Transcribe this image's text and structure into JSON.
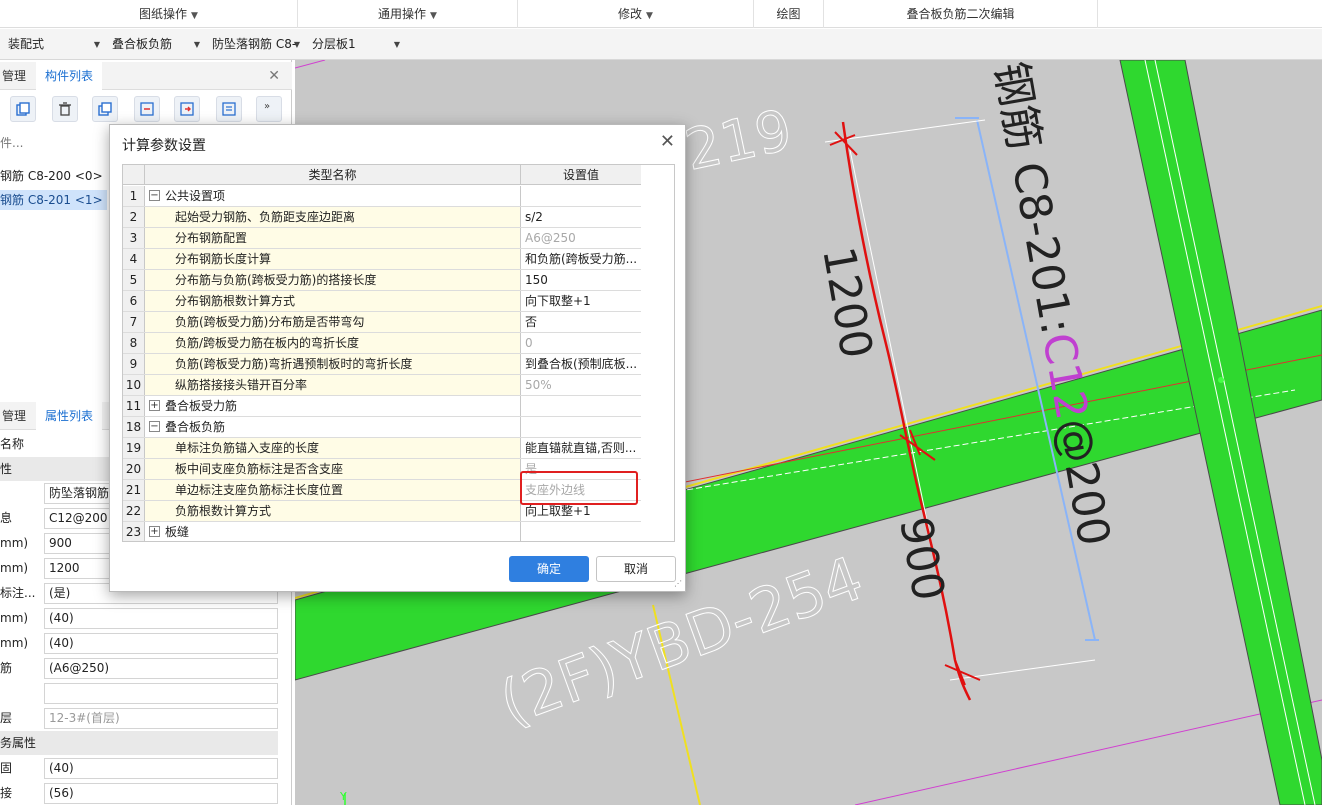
{
  "ribbon": {
    "groups": [
      "图纸操作",
      "通用操作",
      "修改",
      "绘图",
      "叠合板负筋二次编辑"
    ]
  },
  "toolbar": {
    "combos": [
      "装配式",
      "叠合板负筋",
      "防坠落钢筋 C8-",
      "分层板1"
    ]
  },
  "left_panel": {
    "tabs_top": [
      "管理",
      "构件列表"
    ],
    "search_placeholder": "件...",
    "components": [
      {
        "label": "钢筋 C8-200 <0>",
        "selected": false
      },
      {
        "label": "钢筋 C8-201 <1>",
        "selected": true
      }
    ],
    "tabs_bottom": [
      "管理",
      "属性列表"
    ],
    "prop_header": "名称",
    "prop_section1": "性",
    "properties": [
      {
        "label": "",
        "value": "防坠落钢筋",
        "grey": false
      },
      {
        "label": "息",
        "value": "C12@200",
        "grey": false
      },
      {
        "label": "mm)",
        "value": "900",
        "grey": false
      },
      {
        "label": "mm)",
        "value": "1200",
        "grey": false
      },
      {
        "label": "标注...",
        "value": "(是)",
        "grey": false
      },
      {
        "label": "mm)",
        "value": "(40)",
        "grey": false
      },
      {
        "label": "mm)",
        "value": "(40)",
        "grey": false
      },
      {
        "label": "筋",
        "value": "(A6@250)",
        "grey": false
      },
      {
        "label": "",
        "value": "",
        "grey": false
      },
      {
        "label": "层",
        "value": "12-3#(首层)",
        "grey": true
      }
    ],
    "prop_section2": "务属性",
    "properties2": [
      {
        "label": "固",
        "value": "(40)"
      },
      {
        "label": "接",
        "value": "(56)"
      }
    ]
  },
  "canvas": {
    "labels": {
      "top_text": "钢筋 C8-201:",
      "rebar_spec_colored": "C12",
      "rebar_spec_rest": "@200",
      "dim1": "1200",
      "dim2": "900",
      "code1": "219",
      "code2": "(2F)YBD-254",
      "axis_y": "Y"
    },
    "colors": {
      "background": "#c8c8c8",
      "slab_green": "#2fd82f",
      "red_sketch": "#e01010",
      "blue_line": "#8ab4f8",
      "yellow_line": "#f0e020",
      "magenta": "#d040d0"
    }
  },
  "dialog": {
    "title": "计算参数设置",
    "columns": [
      "类型名称",
      "设置值"
    ],
    "rows": [
      {
        "num": "1",
        "name": "公共设置项",
        "value": "",
        "level": 0,
        "tree": "−",
        "grey": false
      },
      {
        "num": "2",
        "name": "起始受力钢筋、负筋距支座边距离",
        "value": "s/2",
        "level": 1,
        "tree": "",
        "grey": false
      },
      {
        "num": "3",
        "name": "分布钢筋配置",
        "value": "A6@250",
        "level": 1,
        "tree": "",
        "grey": true
      },
      {
        "num": "4",
        "name": "分布钢筋长度计算",
        "value": "和负筋(跨板受力筋...",
        "level": 1,
        "tree": "",
        "grey": false
      },
      {
        "num": "5",
        "name": "分布筋与负筋(跨板受力筋)的搭接长度",
        "value": "150",
        "level": 1,
        "tree": "",
        "grey": false
      },
      {
        "num": "6",
        "name": "分布钢筋根数计算方式",
        "value": "向下取整+1",
        "level": 1,
        "tree": "",
        "grey": false
      },
      {
        "num": "7",
        "name": "负筋(跨板受力筋)分布筋是否带弯勾",
        "value": "否",
        "level": 1,
        "tree": "",
        "grey": false
      },
      {
        "num": "8",
        "name": "负筋/跨板受力筋在板内的弯折长度",
        "value": "0",
        "level": 1,
        "tree": "",
        "grey": true
      },
      {
        "num": "9",
        "name": "负筋(跨板受力筋)弯折遇预制板时的弯折长度",
        "value": "到叠合板(预制底板...",
        "level": 1,
        "tree": "",
        "grey": false
      },
      {
        "num": "10",
        "name": "纵筋搭接接头错开百分率",
        "value": "50%",
        "level": 1,
        "tree": "",
        "grey": true
      },
      {
        "num": "11",
        "name": "叠合板受力筋",
        "value": "",
        "level": 0,
        "tree": "+",
        "grey": false
      },
      {
        "num": "18",
        "name": "叠合板负筋",
        "value": "",
        "level": 0,
        "tree": "−",
        "grey": false
      },
      {
        "num": "19",
        "name": "单标注负筋锚入支座的长度",
        "value": "能直锚就直锚,否则...",
        "level": 1,
        "tree": "",
        "grey": false
      },
      {
        "num": "20",
        "name": "板中间支座负筋标注是否含支座",
        "value": "是",
        "level": 1,
        "tree": "",
        "grey": true
      },
      {
        "num": "21",
        "name": "单边标注支座负筋标注长度位置",
        "value": "支座外边线",
        "level": 1,
        "tree": "",
        "grey": true
      },
      {
        "num": "22",
        "name": "负筋根数计算方式",
        "value": "向上取整+1",
        "level": 1,
        "tree": "",
        "grey": false
      },
      {
        "num": "23",
        "name": "板缝",
        "value": "",
        "level": 0,
        "tree": "+",
        "grey": false
      }
    ],
    "ok_label": "确定",
    "cancel_label": "取消"
  }
}
